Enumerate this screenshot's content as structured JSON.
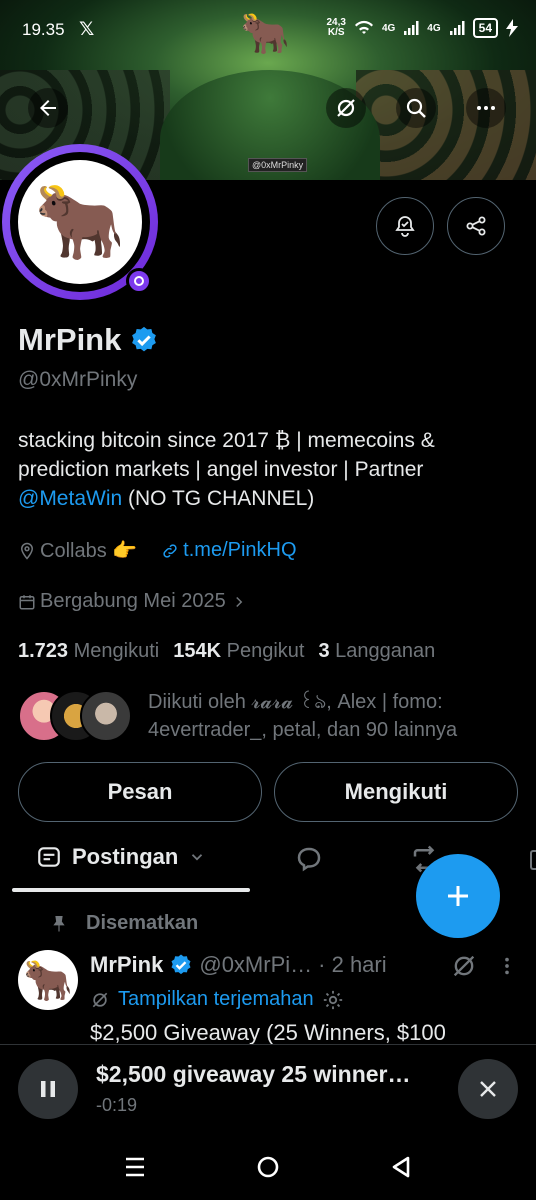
{
  "status_bar": {
    "time": "19.35",
    "x_glyph": "𝕏",
    "net_speed_value": "24,3",
    "net_speed_unit": "K/S",
    "signal1": "4G",
    "signal2": "4G",
    "battery": "54"
  },
  "banner": {
    "sign_text": "@0xMrPinky"
  },
  "profile": {
    "name": "MrPink",
    "handle": "@0xMrPinky",
    "bio_line1": "stacking bitcoin since 2017 ₿ | memecoins &",
    "bio_line2": "prediction markets | angel investor | Partner",
    "bio_mention": "@MetaWin",
    "bio_tail": " (NO TG CHANNEL)",
    "location": "Collabs 👉",
    "link": "t.me/PinkHQ",
    "joined": "Bergabung Mei 2025"
  },
  "stats": {
    "following_count": "1.723",
    "following_label": "Mengikuti",
    "followers_count": "154K",
    "followers_label": "Pengikut",
    "subs_count": "3",
    "subs_label": "Langganan"
  },
  "followed_by": {
    "line1": "Diikuti oleh 𝓻𝓪𝓻𝓪 ꒰ঌ, Alex | fomo:",
    "line2": "4evertrader_, petal, dan 90 lainnya"
  },
  "actions": {
    "message": "Pesan",
    "following": "Mengikuti"
  },
  "tabs": {
    "posts": "Postingan"
  },
  "pinned_post": {
    "pinned_label": "Disematkan",
    "author": "MrPink",
    "handle": "@0xMrPi…",
    "time": "· 2 hari",
    "translate": "Tampilkan terjemahan",
    "text": "$2,500 Giveaway (25 Winners, $100"
  },
  "player": {
    "title": "$2,500 giveaway 25 winner…",
    "time": "-0:19"
  },
  "colors": {
    "accent": "#1d9bf0",
    "ring": "#7c3aed",
    "muted": "#71767b"
  }
}
